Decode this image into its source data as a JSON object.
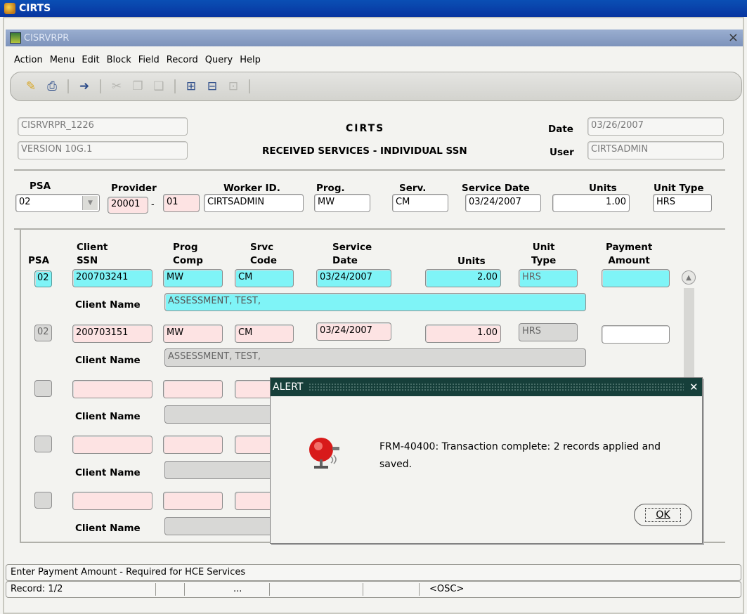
{
  "window": {
    "title": "CIRTS",
    "form_title": "CISRVRPR",
    "close_label": "×"
  },
  "menu": [
    "Action",
    "Menu",
    "Edit",
    "Block",
    "Field",
    "Record",
    "Query",
    "Help"
  ],
  "toolbar": [
    "save-icon",
    "print-icon",
    "exit-icon",
    "cut-icon",
    "copy-icon",
    "paste-icon",
    "insert-record-icon",
    "delete-record-icon",
    "clear-record-icon"
  ],
  "header": {
    "form_id": "CISRVRPR_1226",
    "version": "VERSION 10G.1",
    "system_title": "CIRTS",
    "screen_title": "RECEIVED SERVICES - INDIVIDUAL SSN",
    "date_label": "Date",
    "date_value": "03/26/2007",
    "user_label": "User",
    "user_value": "CIRTSADMIN"
  },
  "entry": {
    "labels": {
      "psa": "PSA",
      "provider": "Provider",
      "worker": "Worker ID.",
      "prog": "Prog.",
      "serv": "Serv.",
      "service_date": "Service Date",
      "units": "Units",
      "unit_type": "Unit Type"
    },
    "psa": "02",
    "provider": "20001",
    "provider_sep": "-",
    "provider_suffix": "01",
    "worker": "CIRTSADMIN",
    "prog": "MW",
    "serv": "CM",
    "service_date": "03/24/2007",
    "units": "1.00",
    "unit_type": "HRS"
  },
  "grid": {
    "headers": {
      "psa": "PSA",
      "client_ssn": "Client\nSSN",
      "prog_comp": "Prog\nComp",
      "srvc_code": "Srvc\nCode",
      "service_date": "Service\nDate",
      "units": "Units",
      "unit_type": "Unit\nType",
      "payment": "Payment\nAmount"
    },
    "client_name_label": "Client Name",
    "rows": [
      {
        "psa": "02",
        "ssn": "200703241",
        "prog": "MW",
        "srvc": "CM",
        "date": "03/24/2007",
        "units": "2.00",
        "type": "HRS",
        "payment": "",
        "name": "ASSESSMENT, TEST,"
      },
      {
        "psa": "02",
        "ssn": "200703151",
        "prog": "MW",
        "srvc": "CM",
        "date": "03/24/2007",
        "units": "1.00",
        "type": "HRS",
        "payment": "",
        "name": "ASSESSMENT, TEST,"
      }
    ]
  },
  "alert": {
    "title": "ALERT",
    "close": "✕",
    "message": "FRM-40400: Transaction complete: 2 records applied and saved.",
    "ok_label": "OK",
    "icon": "alarm-bell-icon"
  },
  "status": {
    "hint": "Enter Payment Amount - Required for HCE Services",
    "record": "Record: 1/2",
    "ellipsis": "...",
    "mode": "<OSC>"
  }
}
